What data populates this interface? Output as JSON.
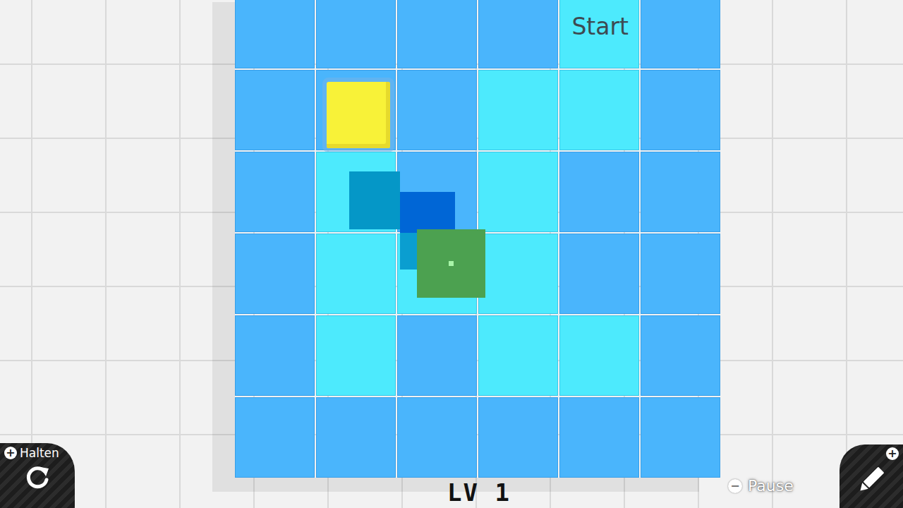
{
  "board": {
    "rows": [
      [
        {
          "kind": "blue"
        },
        {
          "kind": "blue"
        },
        {
          "kind": "blue"
        },
        {
          "kind": "blue"
        },
        {
          "kind": "cyan",
          "label": "Start"
        },
        {
          "kind": "blue"
        }
      ],
      [
        {
          "kind": "blue"
        },
        {
          "kind": "blue",
          "piece": "block"
        },
        {
          "kind": "blue"
        },
        {
          "kind": "cyan"
        },
        {
          "kind": "cyan"
        },
        {
          "kind": "blue"
        }
      ],
      [
        {
          "kind": "blue"
        },
        {
          "kind": "cyan"
        },
        {
          "kind": "blue"
        },
        {
          "kind": "cyan"
        },
        {
          "kind": "blue"
        },
        {
          "kind": "blue"
        }
      ],
      [
        {
          "kind": "blue"
        },
        {
          "kind": "cyan"
        },
        {
          "kind": "cyan"
        },
        {
          "kind": "cyan"
        },
        {
          "kind": "blue"
        },
        {
          "kind": "blue"
        }
      ],
      [
        {
          "kind": "blue"
        },
        {
          "kind": "cyan"
        },
        {
          "kind": "blue"
        },
        {
          "kind": "cyan"
        },
        {
          "kind": "cyan"
        },
        {
          "kind": "blue"
        }
      ],
      [
        {
          "kind": "blue"
        },
        {
          "kind": "blue"
        },
        {
          "kind": "blue"
        },
        {
          "kind": "blue"
        },
        {
          "kind": "blue"
        },
        {
          "kind": "blue"
        }
      ]
    ]
  },
  "hud": {
    "level": "LV 1",
    "hold_button": {
      "icon": "+",
      "label": "Halten"
    },
    "pause_button": {
      "icon": "−",
      "label": "Pause"
    },
    "edit_button": {
      "icon": "+"
    }
  }
}
